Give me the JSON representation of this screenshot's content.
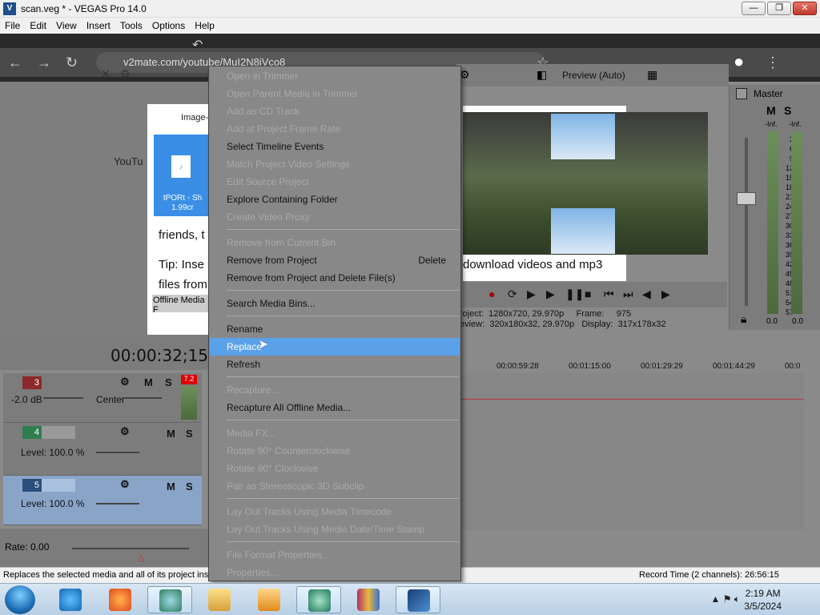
{
  "window": {
    "title": "scan.veg * - VEGAS Pro 14.0",
    "min": "—",
    "max": "❐",
    "close": "✕"
  },
  "menubar": [
    "File",
    "Edit",
    "View",
    "Insert",
    "Tools",
    "Options",
    "Help"
  ],
  "browser": {
    "url": "v2mate.com/youtube/MuI2N8jVco8"
  },
  "preview": {
    "mode": "Preview (Auto)",
    "project_label": "roject:",
    "project_value": "1280x720, 29.970p",
    "frame_label": "Frame:",
    "frame_value": "975",
    "preview_label": "eview:",
    "preview_value": "320x180x32, 29.970p",
    "display_label": "Display:",
    "display_value": "317x178x32"
  },
  "background_page": {
    "youtube": "YouTu",
    "image_tab": "Image-",
    "thumb_caption": "tPORt - Sh 1.99cr",
    "friends": "friends, t",
    "tip": "Tip: Inse",
    "files_from": "files from",
    "download": "download videos and mp3",
    "offline": "Offline Media F"
  },
  "master": {
    "title": "Master",
    "m": "M",
    "s": "S",
    "inf_l": "-Inf.",
    "inf_r": "-Inf.",
    "scale": [
      "3",
      "6",
      "9",
      "12",
      "15",
      "18",
      "21",
      "24",
      "27",
      "30",
      "33",
      "36",
      "39",
      "42",
      "45",
      "48",
      "51",
      "54",
      "57"
    ],
    "val_l": "0.0",
    "val_r": "0.0"
  },
  "timeline": {
    "timecode": "00:00:32;15",
    "ruler": [
      "00:00:59:28",
      "00:01:15:00",
      "00:01:29:29",
      "00:01:44:29",
      "00:0"
    ]
  },
  "tracks": [
    {
      "num": "3",
      "vol": "-2.0 dB",
      "pan": "Center",
      "m": "M",
      "s": "S",
      "meter": "7.2"
    },
    {
      "num": "4",
      "level": "Level: 100.0 %",
      "m": "M",
      "s": "S"
    },
    {
      "num": "5",
      "level": "Level: 100.0 %",
      "m": "M",
      "s": "S"
    }
  ],
  "rate": "Rate: 0.00",
  "status": {
    "left": "Replaces the selected media and all of its project inst",
    "right": "Record Time (2 channels): 26:56:15"
  },
  "context_menu": [
    {
      "label": "Open in Trimmer",
      "enabled": false
    },
    {
      "label": "Open Parent Media in Trimmer",
      "enabled": false
    },
    {
      "label": "Add as CD Track",
      "enabled": false
    },
    {
      "label": "Add at Project Frame Rate",
      "enabled": false
    },
    {
      "label": "Select Timeline Events",
      "enabled": true
    },
    {
      "label": "Match Project Video Settings",
      "enabled": false
    },
    {
      "label": "Edit Source Project",
      "enabled": false
    },
    {
      "label": "Explore Containing Folder",
      "enabled": true
    },
    {
      "label": "Create Video Proxy",
      "enabled": false
    },
    {
      "label": "Remove from Current Bin",
      "enabled": false
    },
    {
      "label": "Remove from Project",
      "enabled": true,
      "shortcut": "Delete"
    },
    {
      "label": "Remove from Project and Delete File(s)",
      "enabled": true
    },
    {
      "label": "Search Media Bins...",
      "enabled": true
    },
    {
      "label": "Rename",
      "enabled": true
    },
    {
      "label": "Replace",
      "enabled": true,
      "highlighted": true
    },
    {
      "label": "Refresh",
      "enabled": true
    },
    {
      "label": "Recapture...",
      "enabled": false
    },
    {
      "label": "Recapture All Offline Media...",
      "enabled": true
    },
    {
      "label": "Media FX...",
      "enabled": false
    },
    {
      "label": "Rotate 90° Counterclockwise",
      "enabled": false
    },
    {
      "label": "Rotate 90° Clockwise",
      "enabled": false
    },
    {
      "label": "Pair as Stereoscopic 3D Subclip",
      "enabled": false
    },
    {
      "label": "Lay Out Tracks Using Media Timecode",
      "enabled": false
    },
    {
      "label": "Lay Out Tracks Using Media Date/Time Stamp",
      "enabled": false
    },
    {
      "label": "File Format Properties...",
      "enabled": false
    },
    {
      "label": "Properties...",
      "enabled": false
    }
  ],
  "taskbar": {
    "time": "2:19 AM",
    "date": "3/5/2024"
  }
}
